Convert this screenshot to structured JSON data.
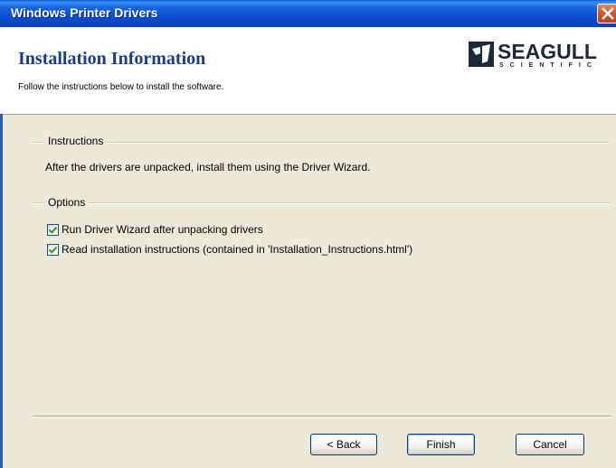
{
  "window": {
    "title": "Windows Printer Drivers"
  },
  "header": {
    "title": "Installation Information",
    "subtitle": "Follow the instructions below to install the software.",
    "logo": {
      "name": "SEAGULL",
      "sub": "SCIENTIFIC"
    }
  },
  "instructions": {
    "label": "Instructions",
    "text": "After the drivers are unpacked, install them using the Driver Wizard."
  },
  "options": {
    "label": "Options",
    "items": [
      {
        "label": "Run Driver Wizard after unpacking drivers",
        "checked": true
      },
      {
        "label": "Read installation instructions (contained in 'Installation_Instructions.html')",
        "checked": true
      }
    ]
  },
  "buttons": {
    "back": "< Back",
    "finish": "Finish",
    "cancel": "Cancel"
  },
  "colors": {
    "titlebar": "#0a4fcf",
    "header_title": "#1a3c8a",
    "dialog_bg": "#ece9d8",
    "close_button": "#d2522a",
    "checkmark": "#21a121"
  },
  "icons": {
    "close": "close-icon",
    "logo": "seagull-logo-icon",
    "check": "checkmark-icon"
  }
}
